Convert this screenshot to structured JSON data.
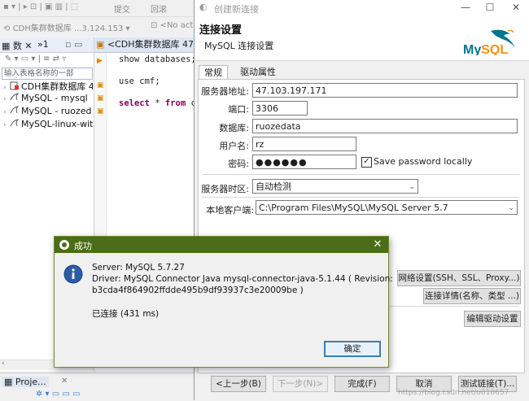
{
  "ide": {
    "toolbar_sql_commit": "提交",
    "toolbar_sql_rollback": "回滚",
    "toolbar_conn_label": "CDH集群数据库 ...3.124.153",
    "toolbar_no_active": "<No acti",
    "nav_tab_label": "数",
    "nav_tab_overflow": "»1",
    "filter_placeholder": "输入表格名称的一部",
    "tree": [
      {
        "label": "CDH集群数据库 4"
      },
      {
        "label": "MySQL - mysql"
      },
      {
        "label": "MySQL - ruozed"
      },
      {
        "label": "MySQL-linux-wit"
      }
    ],
    "editor_tab": "<CDH集群数据库 47.10",
    "code_line1": "show databases;",
    "code_line2": "use cmf;",
    "code_kw_select": "select",
    "code_star": " * ",
    "code_kw_from": "from",
    "code_rest": " cı",
    "proj_tab": "Proje..."
  },
  "conn": {
    "window_title": "创建新连接",
    "header_title": "连接设置",
    "header_subtitle": "MySQL 连接设置",
    "tabs": [
      "常规",
      "驱动属性"
    ],
    "host_label": "服务器地址:",
    "host_value": "47.103.197.171",
    "port_label": "端口:",
    "port_value": "3306",
    "db_label": "数据库:",
    "db_value": "ruozedata",
    "user_label": "用户名:",
    "user_value": "rz",
    "pass_label": "密码:",
    "pass_value": "●●●●●●",
    "save_password_label": "Save password locally",
    "save_password_checked": "✓",
    "timezone_label": "服务器时区:",
    "timezone_value": "自动检测",
    "client_label": "本地客户端:",
    "client_value": "C:\\Program Files\\MySQL\\MySQL Server 5.7",
    "net_settings_btn": "网络设置(SSH、SSL、Proxy...)",
    "conn_details_btn": "连接详情(名称、类型 ...)",
    "edit_driver_btn": "编辑驱动设置",
    "prev_btn": "<上一步(B)",
    "next_btn": "下一步(N)>",
    "finish_btn": "完成(F)",
    "cancel_btn": "取消",
    "test_btn": "测试链接(T)...",
    "logo_text": "MySQL",
    "watermark": "https://blog.csdn.net/u010657"
  },
  "success": {
    "title": "成功",
    "server_line": "Server: MySQL 5.7.27",
    "driver_line1": "Driver: MySQL Connector Java mysql-connector-java-5.1.44 ( Revision:",
    "driver_line2": "b3cda4f864902ffdde495b9df93937c3e20009be )",
    "connected_line": "已连接 (431 ms)",
    "ok_btn": "确定",
    "close_glyph": "✕"
  },
  "colors": {
    "success_titlebar": "#4b6c18",
    "mysql_blue": "#00758f",
    "mysql_orange": "#f29111",
    "keyword": "#7f0055"
  },
  "icons": [
    "info-icon",
    "mysql-logo",
    "close-icon",
    "dropdown-arrow-icon",
    "database-icon"
  ]
}
